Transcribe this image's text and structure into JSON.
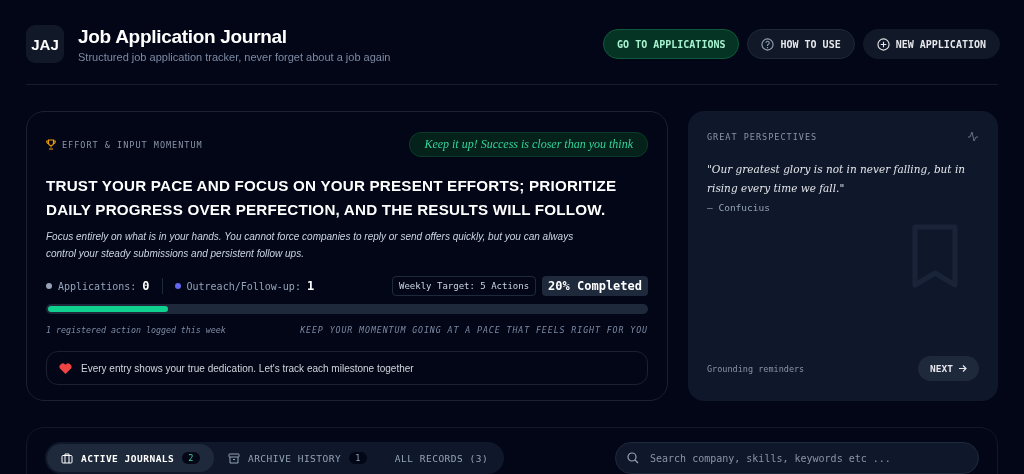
{
  "header": {
    "logo": "JAJ",
    "title": "Job Application Journal",
    "subtitle": "Structured job application tracker, never forget about a job again",
    "buttons": [
      {
        "label": "GO TO APPLICATIONS",
        "kind": "primary"
      },
      {
        "label": "HOW TO USE",
        "kind": "help"
      },
      {
        "label": "NEW APPLICATION",
        "kind": "add"
      }
    ]
  },
  "momentum": {
    "eyebrow": "EFFORT & INPUT MOMENTUM",
    "badge": "Keep it up! Success is closer than you think",
    "headline": "TRUST YOUR PACE AND FOCUS ON YOUR PRESENT EFFORTS; PRIORITIZE DAILY PROGRESS OVER PERFECTION, AND THE RESULTS WILL FOLLOW.",
    "body": "Focus entirely on what is in your hands. You cannot force companies to reply or send offers quickly, but you can always control your steady submissions and persistent follow ups.",
    "stats": [
      {
        "label": "Applications:",
        "value": "0",
        "color": "#94a3b8"
      },
      {
        "label": "Outreach/Follow-up:",
        "value": "1",
        "color": "#6366f1"
      }
    ],
    "target": "Weekly Target: 5 Actions",
    "completed": "20% Completed",
    "level": 0.2,
    "logged": "1 registered action logged this week",
    "motto": "KEEP YOUR MOMENTUM GOING AT A PACE THAT FEELS RIGHT FOR YOU",
    "note": "Every entry shows your true dedication. Let's track each milestone together"
  },
  "perspectives": {
    "title": "GREAT PERSPECTIVES",
    "quote": "\"Our greatest glory is not in never falling, but in rising every time we fall.\"",
    "author": "— Confucius",
    "footer": "Grounding reminders",
    "next": "NEXT"
  },
  "tabs": [
    {
      "label": "ACTIVE JOURNALS",
      "count": "2",
      "kind": "journal",
      "selected": true
    },
    {
      "label": "ARCHIVE HISTORY",
      "count": "1",
      "kind": "archive",
      "selected": false
    },
    {
      "label": "ALL RECORDS (3)",
      "kind": "plain",
      "selected": false
    }
  ],
  "search": {
    "placeholder": "Search company, skills, keywords etc ..."
  }
}
